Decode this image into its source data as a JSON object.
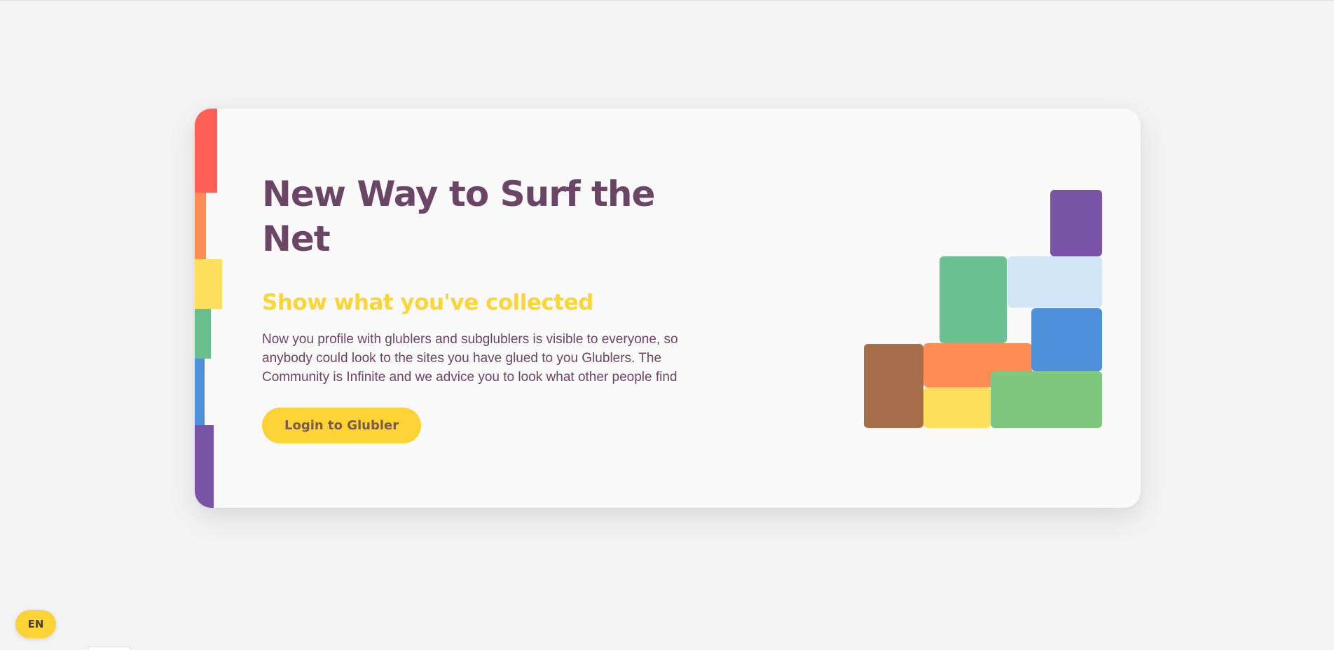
{
  "hero": {
    "title": "New Way to Surf the Net",
    "subtitle": "Show what you've collected",
    "description": "Now you profile with glublers and subglublers is visible to everyone, so anybody could look to the sites you have glued to you Glublers. The Community is Infinite and we advice you to look what other people find",
    "cta_label": "Login to Glubler"
  },
  "language": {
    "label": "EN"
  },
  "colors": {
    "title": "#6b4566",
    "subtitle": "#fcd535",
    "accent": "#fcd335",
    "stripe": [
      "#ff5f55",
      "#ff8c55",
      "#ffdf5c",
      "#66bf8d",
      "#4e91db",
      "#7a52a6"
    ],
    "blocks": {
      "purple": "#7a52a6",
      "green": "#69c28f",
      "light_blue": "#d2e4f8",
      "blue": "#4e91db",
      "brown": "#a66d49",
      "orange": "#ff8c55",
      "yellow": "#ffdf5c",
      "light_green": "#7ec77c"
    }
  }
}
